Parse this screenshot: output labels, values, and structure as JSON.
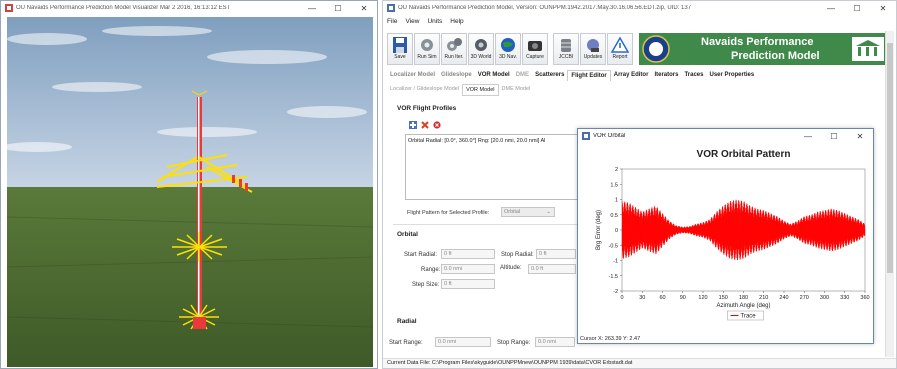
{
  "visualizer": {
    "title": "OU Navaids Performance Prediction Model Visualizer Mar 2 2016, 16:13:12 EST",
    "controls": [
      "—",
      "☐",
      "✕"
    ]
  },
  "main": {
    "title": "OU Navaids Performance Prediction Model, Version: OUNPPM.1942.2017.May.30.16.06.56.EDT.zip, UID: 137",
    "controls": [
      "—",
      "☐",
      "✕"
    ],
    "menu": [
      "File",
      "View",
      "Units",
      "Help"
    ],
    "toolbar": [
      "Save",
      "Run Sim",
      "Run Iter.",
      "3D World",
      "3D Nav.",
      "Capture",
      "JCCBI",
      "Updates",
      "Report"
    ],
    "logo_line1": "Navaids Performance",
    "logo_line2": "Prediction Model",
    "tabs": [
      "Localizer Model",
      "Glideslope",
      "VOR Model",
      "DME",
      "Scatterers",
      "Flight Editor",
      "Array Editor",
      "Iterators",
      "Traces",
      "User Properties"
    ],
    "subtabs": [
      "Localizer / Glideslope Model",
      "VOR Model",
      "DME Model"
    ],
    "profiles_title": "VOR Flight Profiles",
    "profile_entry": "Orbital   Radial: [0.0°, 360.0°]   Rng: [20.0 nmi, 20.0 nmi]   Al",
    "pattern_label": "Flight Pattern for Selected Profile:",
    "pattern_value": "Orbital",
    "orbital_title": "Orbital",
    "start_radial_label": "Start Radial:",
    "start_radial_value": "0 ft",
    "stop_radial_label": "Stop Radial:",
    "stop_radial_value": "0 ft",
    "range_label": "Range:",
    "range_value": "0.0 nmi",
    "altitude_label": "Altitude:",
    "altitude_value": "0.0 ft",
    "step_label": "Step Size:",
    "step_value": "0 ft",
    "radial_title": "Radial",
    "start_range_label": "Start Range:",
    "start_range_value": "0.0 nmi",
    "stop_range_label": "Stop Range:",
    "stop_range_value": "0.0 nmi",
    "status_text": "Current Data File:   C:\\Program Files\\skyguide\\OUNPPMnew\\OUNPPM 1939\\data\\CVOR Erbstadt.dat"
  },
  "orbital_window": {
    "title": "VOR Orbital",
    "controls": [
      "—",
      "☐",
      "✕"
    ],
    "cursor": "Cursor X: 263.39 Y: 2.47"
  },
  "chart_data": {
    "type": "line",
    "title": "VOR Orbital Pattern",
    "xlabel": "Azimuth Angle (deg)",
    "ylabel": "Brg Error (deg)",
    "xlim": [
      0,
      360
    ],
    "ylim": [
      -2,
      2
    ],
    "xticks": [
      0,
      30,
      60,
      90,
      120,
      150,
      180,
      210,
      240,
      270,
      300,
      330,
      360
    ],
    "yticks": [
      2,
      1.5,
      1,
      0.5,
      0,
      -0.5,
      -1,
      -1.5,
      -2
    ],
    "grid": false,
    "legend_position": "bottom-center",
    "series": [
      {
        "name": "Trace",
        "color": "#ff0000",
        "envelope_x": [
          0,
          10,
          20,
          30,
          40,
          50,
          60,
          70,
          80,
          90,
          100,
          110,
          120,
          130,
          140,
          150,
          160,
          170,
          180,
          190,
          200,
          210,
          220,
          230,
          240,
          250,
          260,
          270,
          280,
          290,
          300,
          310,
          320,
          330,
          340,
          350,
          360
        ],
        "envelope_amp": [
          0.95,
          0.9,
          0.75,
          0.6,
          0.7,
          0.8,
          0.55,
          0.3,
          0.15,
          0.1,
          0.12,
          0.2,
          0.25,
          0.35,
          0.6,
          0.8,
          0.95,
          1.0,
          0.95,
          0.8,
          0.7,
          0.65,
          0.55,
          0.45,
          0.3,
          0.2,
          0.3,
          0.45,
          0.5,
          0.6,
          0.65,
          0.7,
          0.65,
          0.55,
          0.45,
          0.35,
          0.2
        ]
      }
    ]
  }
}
